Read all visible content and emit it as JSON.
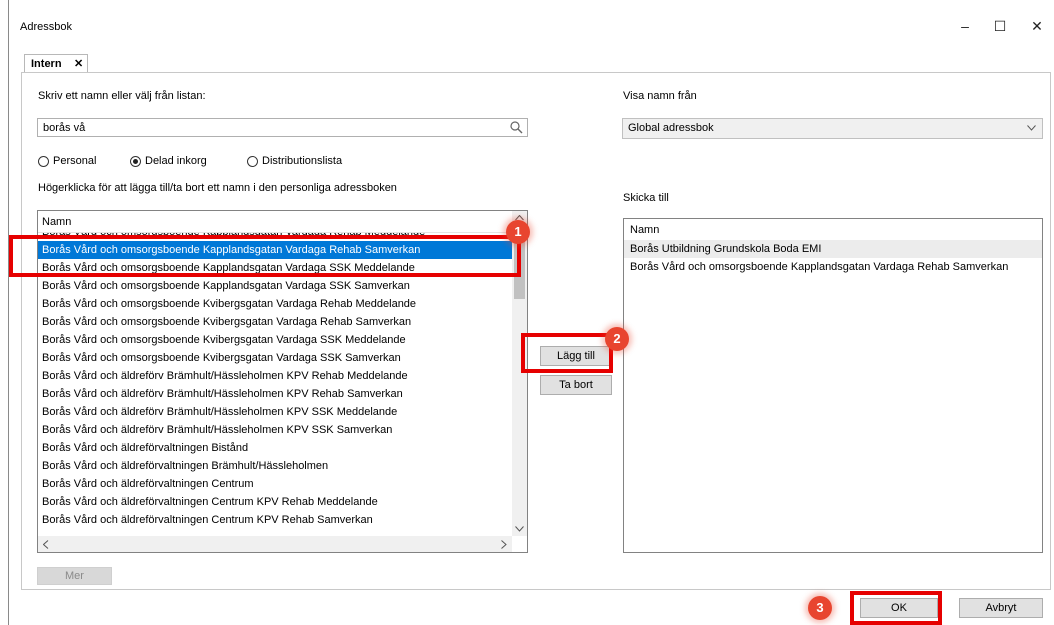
{
  "window": {
    "title": "Adressbok",
    "minimize_glyph": "–",
    "maximize_glyph": "☐",
    "close_glyph": "✕"
  },
  "tab": {
    "label": "Intern",
    "close_glyph": "✕"
  },
  "search": {
    "label": "Skriv ett namn eller välj från listan:",
    "value": "borås vå",
    "icon": "search-icon"
  },
  "visa": {
    "label": "Visa namn från",
    "selected": "Global adressbok"
  },
  "radios": [
    {
      "label": "Personal",
      "selected": false
    },
    {
      "label": "Delad inkorg",
      "selected": true
    },
    {
      "label": "Distributionslista",
      "selected": false
    }
  ],
  "hint": "Högerklicka för att lägga till/ta bort ett namn i den personliga adressboken",
  "left_list": {
    "header": "Namn",
    "rows": [
      "Borås Vård och omsorgsboende Kapplandsgatan Vardaga Rehab Meddelande",
      "Borås Vård och omsorgsboende Kapplandsgatan Vardaga Rehab Samverkan",
      "Borås Vård och omsorgsboende Kapplandsgatan Vardaga SSK Meddelande",
      "Borås Vård och omsorgsboende Kapplandsgatan Vardaga SSK Samverkan",
      "Borås Vård och omsorgsboende Kvibergsgatan Vardaga Rehab Meddelande",
      "Borås Vård och omsorgsboende Kvibergsgatan Vardaga Rehab Samverkan",
      "Borås Vård och omsorgsboende Kvibergsgatan Vardaga SSK Meddelande",
      "Borås Vård och omsorgsboende Kvibergsgatan Vardaga SSK Samverkan",
      "Borås Vård och äldreförv Brämhult/Hässleholmen KPV Rehab Meddelande",
      "Borås Vård och äldreförv Brämhult/Hässleholmen KPV Rehab Samverkan",
      "Borås Vård och äldreförv Brämhult/Hässleholmen KPV SSK Meddelande",
      "Borås Vård och äldreförv Brämhult/Hässleholmen KPV SSK Samverkan",
      "Borås Vård och äldreförvaltningen Bistånd",
      "Borås Vård och äldreförvaltningen Brämhult/Hässleholmen",
      "Borås Vård och äldreförvaltningen Centrum",
      "Borås Vård och äldreförvaltningen Centrum KPV Rehab Meddelande",
      "Borås Vård och äldreförvaltningen Centrum KPV Rehab Samverkan"
    ],
    "selected_index": 1
  },
  "buttons": {
    "add": "Lägg till",
    "remove": "Ta bort",
    "more": "Mer",
    "ok": "OK",
    "cancel": "Avbryt"
  },
  "send_to": {
    "label": "Skicka till",
    "header": "Namn",
    "rows": [
      "Borås  Utbildning Grundskola Boda  EMI",
      "Borås Vård och omsorgsboende Kapplandsgatan Vardaga Rehab Samverkan"
    ]
  },
  "badges": [
    "1",
    "2",
    "3"
  ],
  "colors": {
    "selection": "#0078d7",
    "highlight": "#e60000",
    "badge": "#e8452f"
  }
}
